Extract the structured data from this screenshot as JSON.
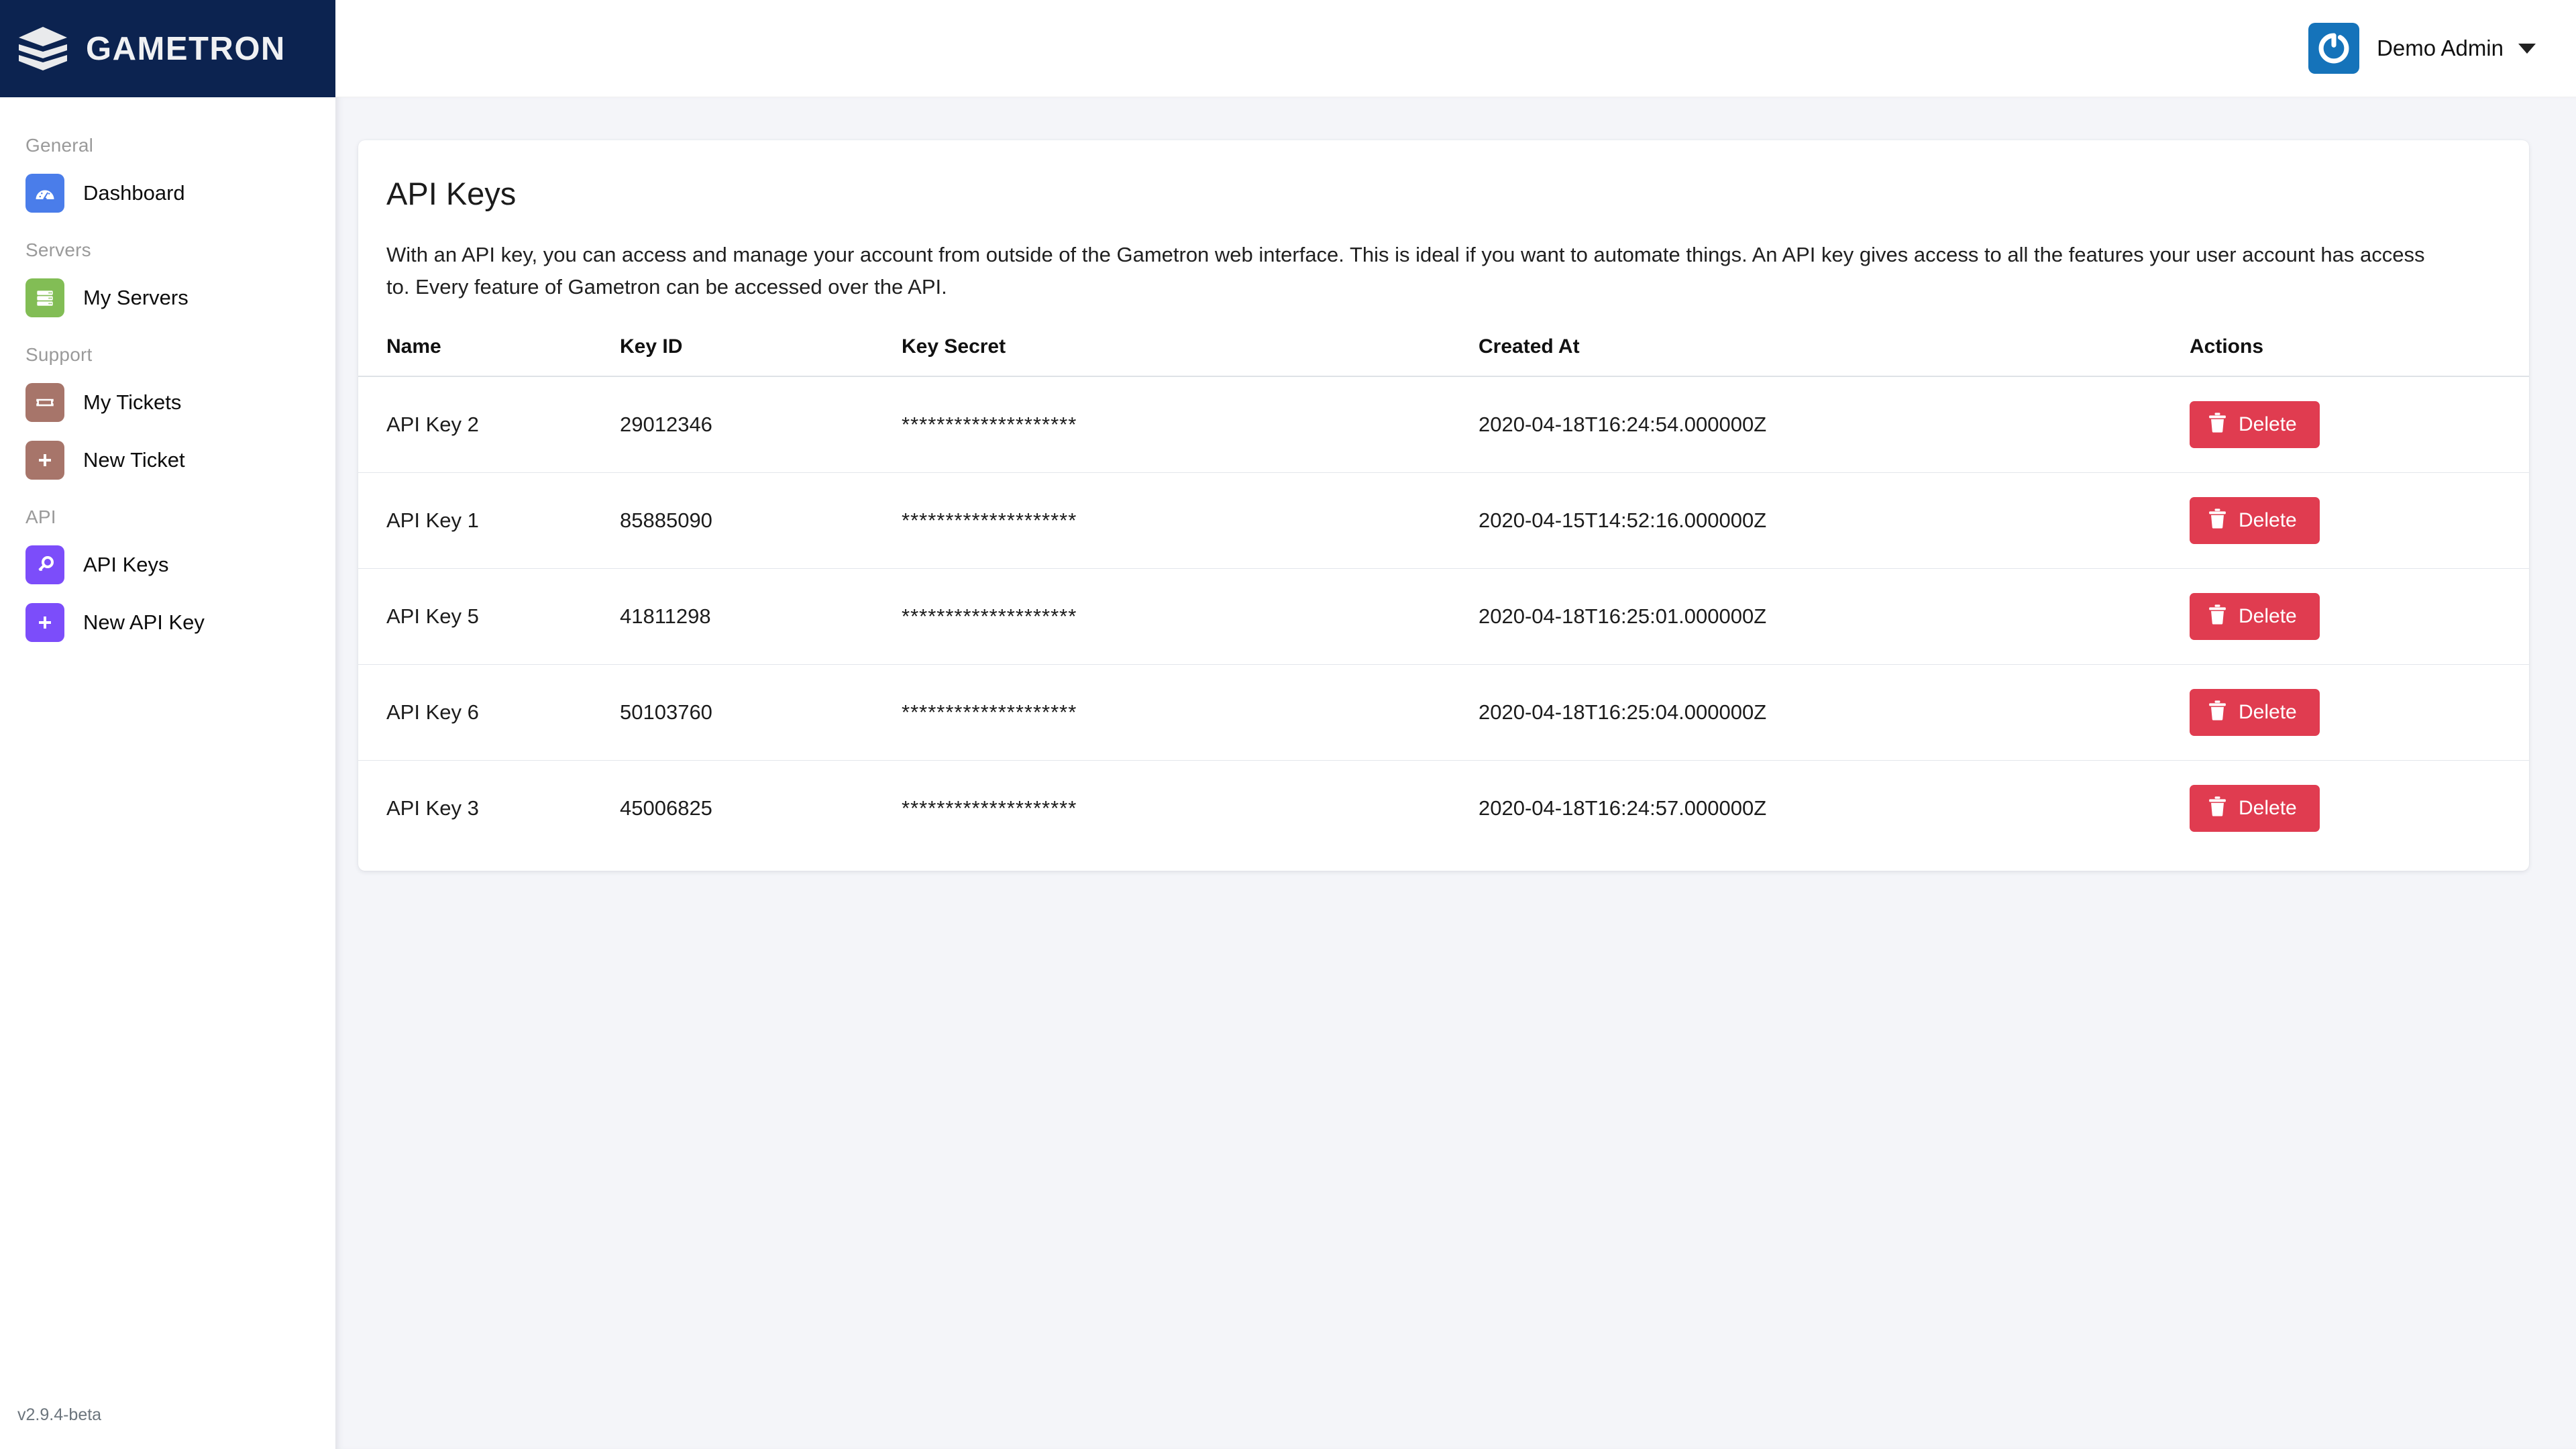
{
  "brand": {
    "name": "GAMETRON",
    "logo_icon": "stacked-layers-icon",
    "bg_color": "#0c2350"
  },
  "sidebar": {
    "version": "v2.9.4-beta",
    "sections": [
      {
        "label": "General",
        "items": [
          {
            "label": "Dashboard",
            "icon": "gauge-icon",
            "icon_color": "#4a7dea",
            "active": false
          }
        ]
      },
      {
        "label": "Servers",
        "items": [
          {
            "label": "My Servers",
            "icon": "server-rack-icon",
            "icon_color": "#82bd55",
            "active": false
          }
        ]
      },
      {
        "label": "Support",
        "items": [
          {
            "label": "My Tickets",
            "icon": "ticket-icon",
            "icon_color": "#a7756a",
            "active": false
          },
          {
            "label": "New Ticket",
            "icon": "plus-icon",
            "icon_color": "#a7756a",
            "active": false
          }
        ]
      },
      {
        "label": "API",
        "items": [
          {
            "label": "API Keys",
            "icon": "key-icon",
            "icon_color": "#7c4dfa",
            "active": true
          },
          {
            "label": "New API Key",
            "icon": "plus-icon",
            "icon_color": "#7c4dfa",
            "active": false
          }
        ]
      }
    ]
  },
  "topbar": {
    "avatar_icon": "gravatar-g-icon",
    "avatar_color": "#1573ba",
    "user_name": "Demo Admin",
    "caret_icon": "chevron-down-icon"
  },
  "page": {
    "title": "API Keys",
    "description": "With an API key, you can access and manage your account from outside of the Gametron web interface. This is ideal if you want to automate things. An API key gives access to all the features your user account has access to. Every feature of Gametron can be accessed over the API."
  },
  "table": {
    "columns": [
      "Name",
      "Key ID",
      "Key Secret",
      "Created At",
      "Actions"
    ],
    "delete_label": "Delete",
    "delete_icon": "trash-icon",
    "delete_color": "#e03c50",
    "rows": [
      {
        "name": "API Key 2",
        "key_id": "29012346",
        "key_secret": "********************",
        "created_at": "2020-04-18T16:24:54.000000Z"
      },
      {
        "name": "API Key 1",
        "key_id": "85885090",
        "key_secret": "********************",
        "created_at": "2020-04-15T14:52:16.000000Z"
      },
      {
        "name": "API Key 5",
        "key_id": "41811298",
        "key_secret": "********************",
        "created_at": "2020-04-18T16:25:01.000000Z"
      },
      {
        "name": "API Key 6",
        "key_id": "50103760",
        "key_secret": "********************",
        "created_at": "2020-04-18T16:25:04.000000Z"
      },
      {
        "name": "API Key 3",
        "key_id": "45006825",
        "key_secret": "********************",
        "created_at": "2020-04-18T16:24:57.000000Z"
      }
    ]
  }
}
